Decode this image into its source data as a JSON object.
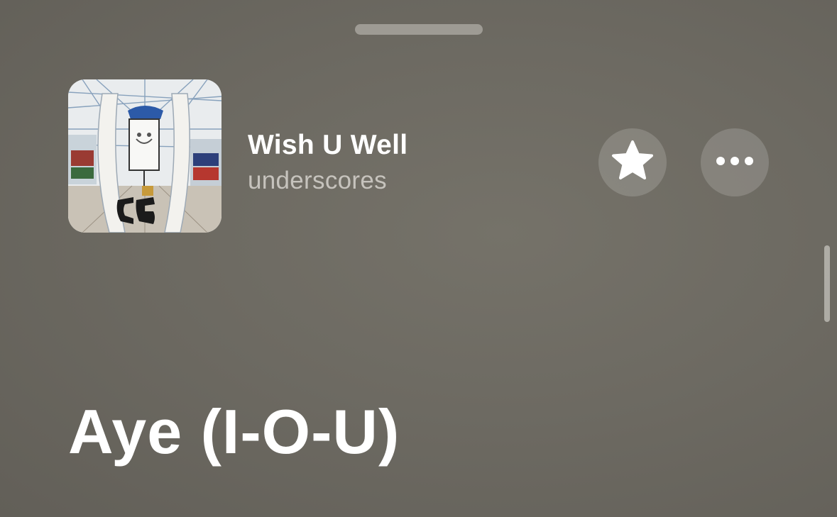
{
  "now_playing": {
    "title": "Wish U Well",
    "artist": "underscores",
    "artwork_icon": "album-artwork"
  },
  "actions": {
    "favorite_icon": "star-icon",
    "more_icon": "ellipsis-icon"
  },
  "lyrics": {
    "current_line": "Aye (I-O-U)"
  },
  "colors": {
    "background": "#6d6a62",
    "title": "#ffffff",
    "artist": "#c6c3bd"
  }
}
